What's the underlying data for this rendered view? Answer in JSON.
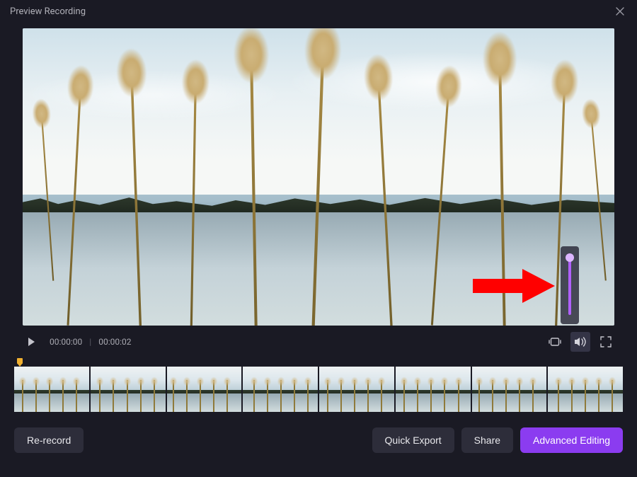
{
  "window": {
    "title": "Preview Recording"
  },
  "player": {
    "current_time": "00:00:00",
    "duration": "00:00:02"
  },
  "volume": {
    "level_percent": 100
  },
  "footer": {
    "rerecord_label": "Re-record",
    "quick_export_label": "Quick Export",
    "share_label": "Share",
    "advanced_label": "Advanced Editing"
  },
  "colors": {
    "accent": "#8b3cf0",
    "volume_track": "#b060ff",
    "playhead": "#f0b030",
    "annotation": "#ff0000"
  }
}
